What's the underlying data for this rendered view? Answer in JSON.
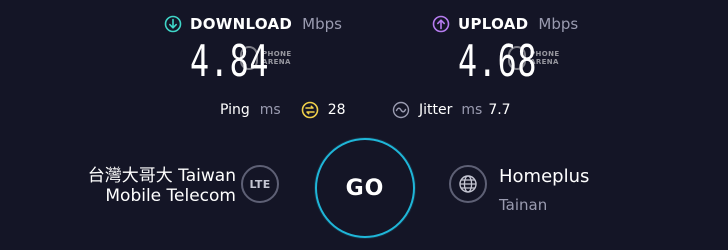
{
  "download": {
    "title": "DOWNLOAD",
    "unit": "Mbps",
    "value": "4.84",
    "icon": "download-arrow-icon",
    "color": "#3fd6c8"
  },
  "upload": {
    "title": "UPLOAD",
    "unit": "Mbps",
    "value": "4.68",
    "icon": "upload-arrow-icon",
    "color": "#b67cf0"
  },
  "watermark": {
    "line1": "PHONE",
    "line2": "ARENA"
  },
  "ping": {
    "label": "Ping",
    "unit": "ms",
    "value": "28",
    "color": "#f0d04a"
  },
  "jitter": {
    "label": "Jitter",
    "unit": "ms",
    "value": "7.7"
  },
  "provider": {
    "name_line1": "台灣大哥大 Taiwan",
    "name_line2": "Mobile Telecom",
    "network_type": "LTE"
  },
  "go_button": {
    "label": "GO",
    "ring_color": "#1fb6d8"
  },
  "server": {
    "name": "Homeplus",
    "location": "Tainan",
    "icon": "globe-icon"
  }
}
